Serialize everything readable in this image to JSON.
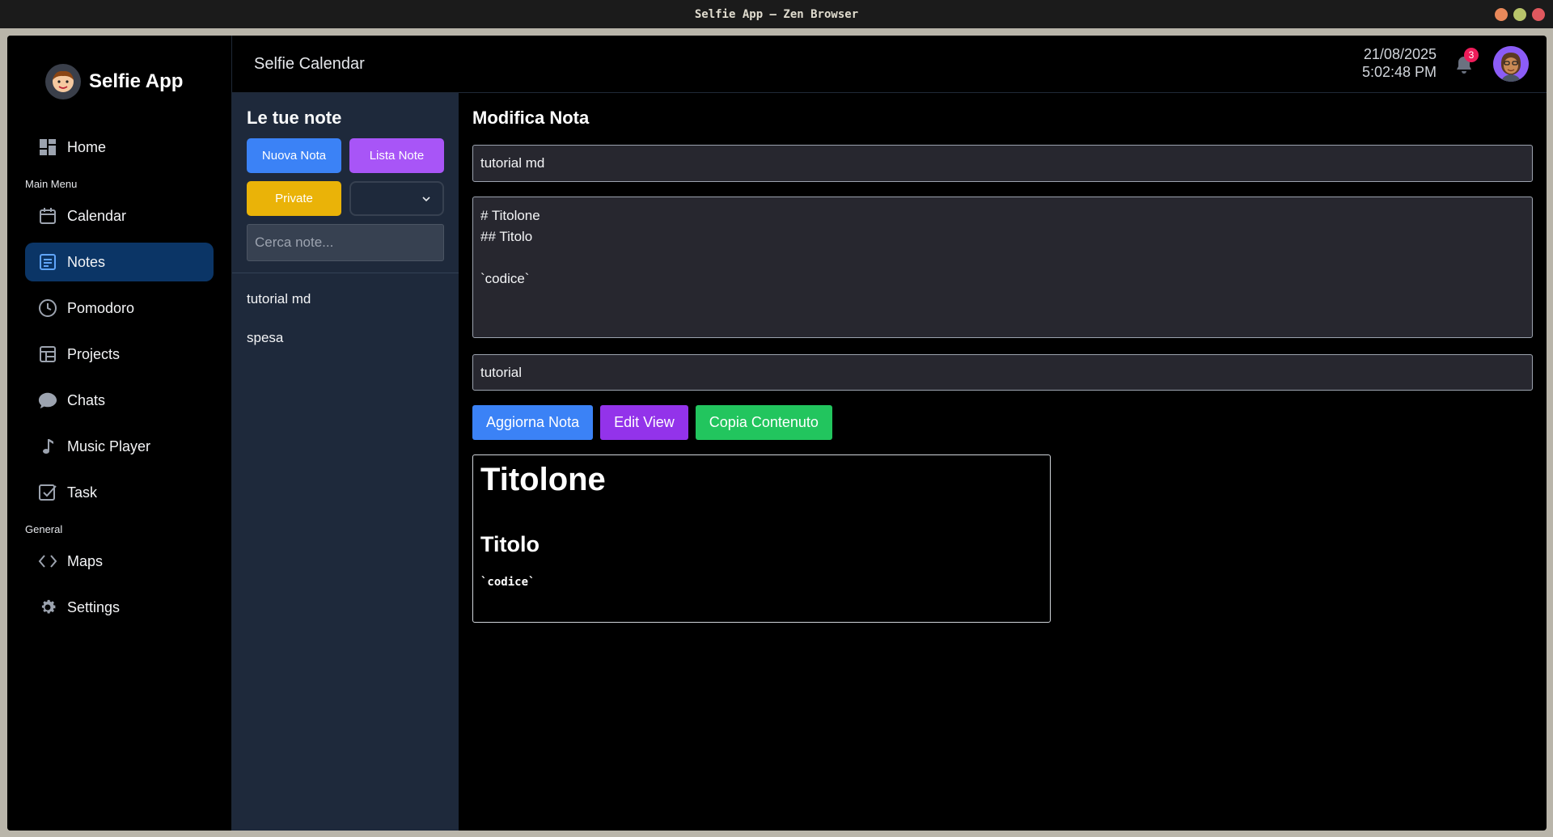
{
  "window": {
    "title": "Selfie App — Zen Browser",
    "controls": [
      {
        "name": "minimize",
        "color": "#e8885a"
      },
      {
        "name": "maximize",
        "color": "#b8c46a"
      },
      {
        "name": "close",
        "color": "#e0585e"
      }
    ]
  },
  "sidebar": {
    "brand": "Selfie App",
    "home": {
      "label": "Home",
      "icon": "dashboard-icon"
    },
    "main_menu_label": "Main Menu",
    "main_items": [
      {
        "label": "Calendar",
        "icon": "calendar-icon"
      },
      {
        "label": "Notes",
        "icon": "notes-icon",
        "active": true
      },
      {
        "label": "Pomodoro",
        "icon": "clock-icon"
      },
      {
        "label": "Projects",
        "icon": "grid-icon"
      },
      {
        "label": "Chats",
        "icon": "chat-bubble-icon"
      },
      {
        "label": "Music Player",
        "icon": "music-note-icon"
      },
      {
        "label": "Task",
        "icon": "checkbox-icon"
      }
    ],
    "general_label": "General",
    "general_items": [
      {
        "label": "Maps",
        "icon": "code-brackets-icon"
      },
      {
        "label": "Settings",
        "icon": "gear-icon"
      }
    ]
  },
  "header": {
    "title": "Selfie Calendar",
    "date": "21/08/2025",
    "time": "5:02:48 PM",
    "notification_count": "3"
  },
  "notes_panel": {
    "title": "Le tue note",
    "new_note": "Nuova Nota",
    "list_notes": "Lista Note",
    "private": "Private",
    "search_placeholder": "Cerca note...",
    "notes": [
      "tutorial md",
      "spesa"
    ]
  },
  "editor": {
    "heading": "Modifica Nota",
    "title_value": "tutorial md",
    "body_value": "# Titolone\n## Titolo\n\n`codice`",
    "tag_value": "tutorial",
    "update_button": "Aggiorna Nota",
    "edit_view_button": "Edit View",
    "copy_button": "Copia Contenuto",
    "preview": {
      "h1": "Titolone",
      "h2": "Titolo",
      "code": "`codice`"
    }
  },
  "colors": {
    "active_nav": "#0b3566",
    "blue": "#3b82f6",
    "purple": "#a855f7",
    "yellow": "#eab308",
    "green": "#22c55e",
    "badge": "#ef1c5a"
  }
}
